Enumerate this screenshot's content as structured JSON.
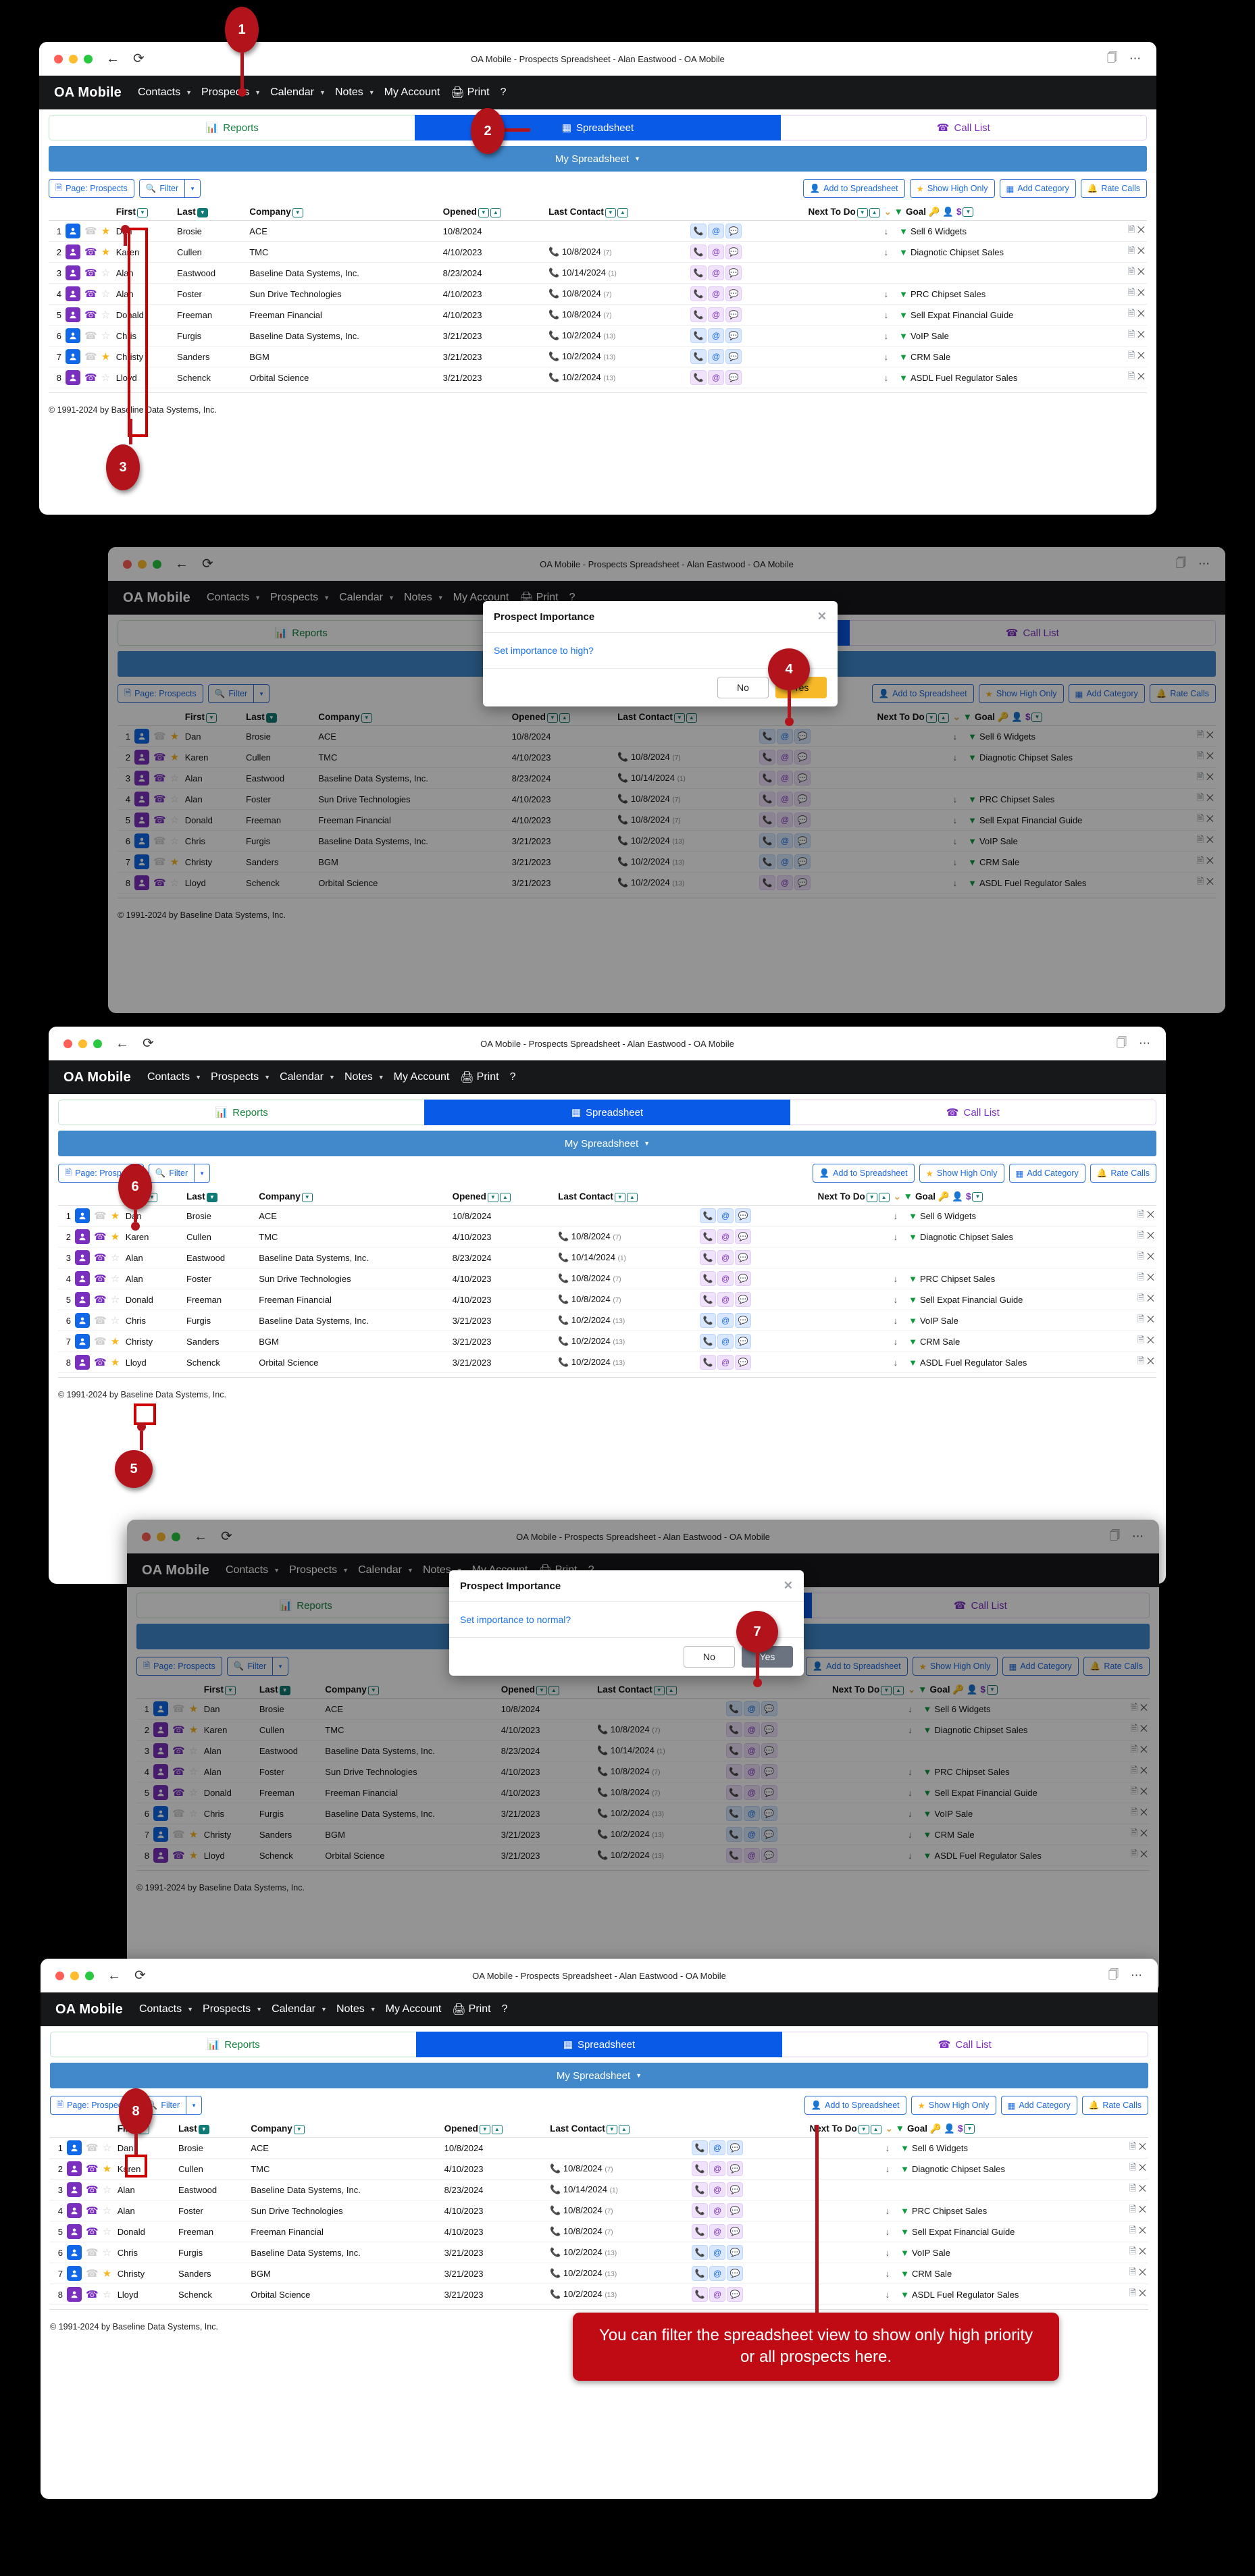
{
  "window": {
    "title": "OA Mobile - Prospects Spreadsheet - Alan Eastwood - OA Mobile",
    "back_icon": "back-arrow-icon",
    "reload_icon": "reload-icon",
    "reader_icon": "reader-view-icon",
    "more_icon": "more-options-icon"
  },
  "nav": {
    "brand": "OA Mobile",
    "items": [
      {
        "label": "Contacts",
        "has_caret": true
      },
      {
        "label": "Prospects",
        "has_caret": true
      },
      {
        "label": "Calendar",
        "has_caret": true
      },
      {
        "label": "Notes",
        "has_caret": true
      },
      {
        "label": "My Account",
        "has_caret": false
      },
      {
        "label": "Print",
        "has_caret": false
      },
      {
        "label": "?",
        "has_caret": false
      }
    ]
  },
  "tabs": {
    "reports": "Reports",
    "spreadsheet": "Spreadsheet",
    "call_list": "Call List",
    "active": "Spreadsheet"
  },
  "sheet_selector": "My Spreadsheet",
  "toolbar": {
    "page": "Page: Prospects",
    "filter": "Filter",
    "filter_caret": "chevron-down-icon",
    "add_to_spreadsheet": "Add to Spreadsheet",
    "show_high_only": "Show High Only",
    "add_category": "Add Category",
    "rate_calls": "Rate Calls"
  },
  "table": {
    "headers": {
      "first": "First",
      "last": "Last",
      "company": "Company",
      "opened": "Opened",
      "last_contact": "Last Contact",
      "next_to_do": "Next To Do",
      "goal": "Goal"
    },
    "rows": [
      {
        "n": "1",
        "chip": "blue",
        "phone": "grey",
        "star": "on",
        "first": "Dan",
        "last": "Brosie",
        "company": "ACE",
        "opened": "10/8/2024",
        "last_contact": "",
        "contact_count": "",
        "act": "blue",
        "goal": "Sell 6 Widgets"
      },
      {
        "n": "2",
        "chip": "purp",
        "phone": "purp",
        "star": "on",
        "first": "Karen",
        "last": "Cullen",
        "company": "TMC",
        "opened": "4/10/2023",
        "last_contact": "10/8/2024",
        "contact_count": "(7)",
        "act": "purp",
        "goal": "Diagnotic Chipset Sales"
      },
      {
        "n": "3",
        "chip": "purp",
        "phone": "purp",
        "star": "off",
        "first": "Alan",
        "last": "Eastwood",
        "company": "Baseline Data Systems, Inc.",
        "opened": "8/23/2024",
        "last_contact": "10/14/2024",
        "contact_count": "(1)",
        "act": "purp",
        "goal": ""
      },
      {
        "n": "4",
        "chip": "purp",
        "phone": "purp",
        "star": "off",
        "first": "Alan",
        "last": "Foster",
        "company": "Sun Drive Technologies",
        "opened": "4/10/2023",
        "last_contact": "10/8/2024",
        "contact_count": "(7)",
        "act": "purp",
        "goal": "PRC Chipset Sales"
      },
      {
        "n": "5",
        "chip": "purp",
        "phone": "purp",
        "star": "off",
        "first": "Donald",
        "last": "Freeman",
        "company": "Freeman Financial",
        "opened": "4/10/2023",
        "last_contact": "10/8/2024",
        "contact_count": "(7)",
        "act": "purp",
        "goal": "Sell Expat Financial Guide"
      },
      {
        "n": "6",
        "chip": "blue",
        "phone": "grey",
        "star": "off",
        "first": "Chris",
        "last": "Furgis",
        "company": "Baseline Data Systems, Inc.",
        "opened": "3/21/2023",
        "last_contact": "10/2/2024",
        "contact_count": "(13)",
        "act": "blue",
        "goal": "VoIP Sale"
      },
      {
        "n": "7",
        "chip": "blue",
        "phone": "grey",
        "star": "on",
        "first": "Christy",
        "last": "Sanders",
        "company": "BGM",
        "opened": "3/21/2023",
        "last_contact": "10/2/2024",
        "contact_count": "(13)",
        "act": "blue",
        "goal": "CRM Sale"
      },
      {
        "n": "8",
        "chip": "purp",
        "phone": "purp",
        "star": "off",
        "first": "Lloyd",
        "last": "Schenck",
        "company": "Orbital Science",
        "opened": "3/21/2023",
        "last_contact": "10/2/2024",
        "contact_count": "(13)",
        "act": "purp",
        "goal": "ASDL Fuel Regulator Sales"
      }
    ]
  },
  "row8_star_panel3": "on",
  "row1_star_panel5": "off",
  "footer": "© 1991-2024 by Baseline Data Systems, Inc.",
  "dialog_high": {
    "title": "Prospect Importance",
    "close_icon": "close-icon",
    "body": "Set importance to high?",
    "no": "No",
    "yes": "Yes"
  },
  "dialog_normal": {
    "title": "Prospect Importance",
    "close_icon": "close-icon",
    "body": "Set importance to normal?",
    "no": "No",
    "yes": "Yes"
  },
  "callouts": {
    "c1": "1",
    "c2": "2",
    "c3": "3",
    "c4": "4",
    "c5": "5",
    "c6": "6",
    "c7": "7",
    "c8": "8"
  },
  "tip": "You can filter the spreadsheet view to show only high priority or all prospects here."
}
